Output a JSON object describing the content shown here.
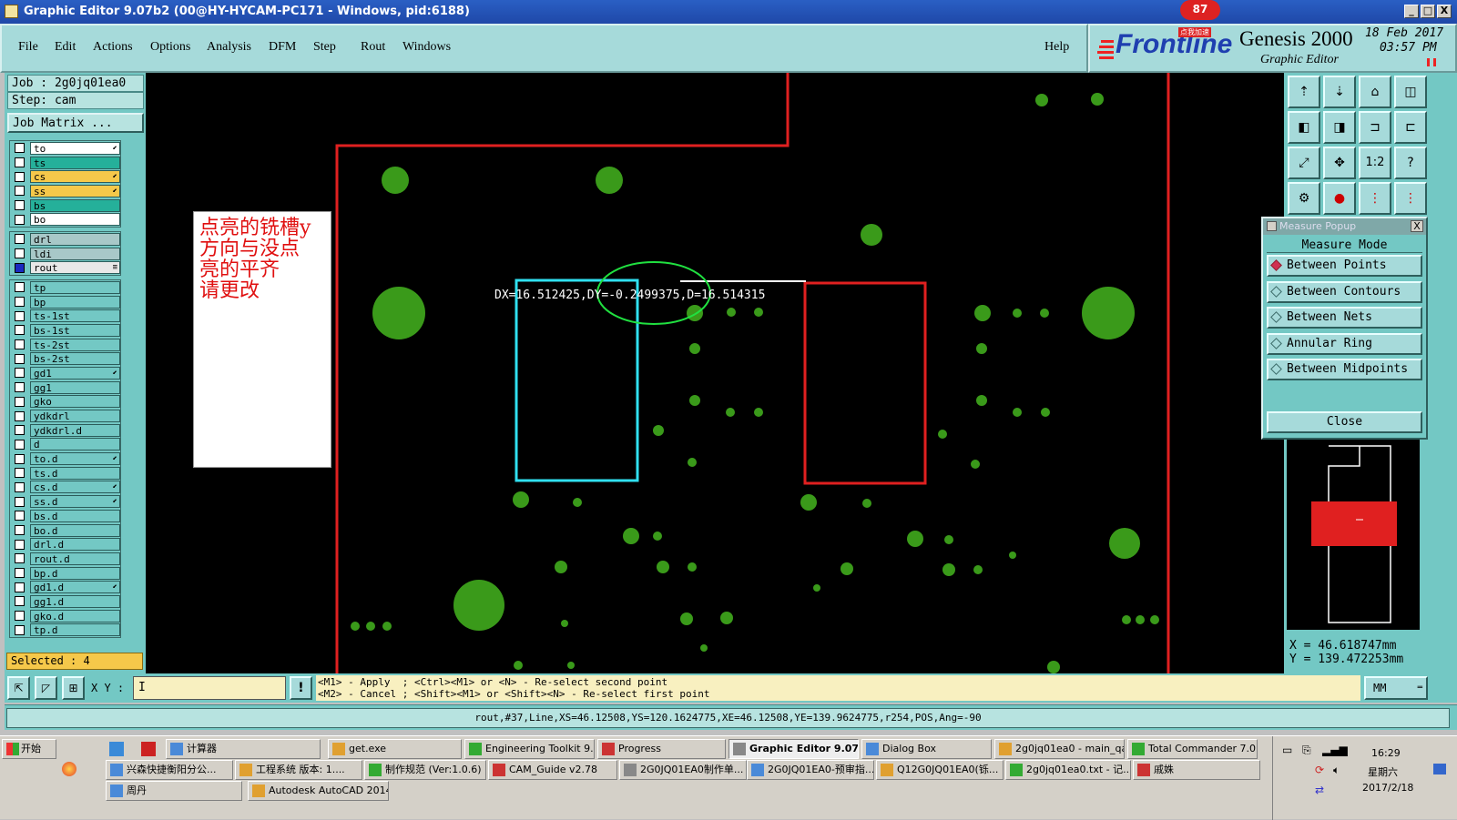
{
  "window": {
    "title": "Graphic Editor 9.07b2 (00@HY-HYCAM-PC171 - Windows, pid:6188)",
    "minimize": "_",
    "maximize": "□",
    "close": "X"
  },
  "badge": {
    "count": "87",
    "text": "点我加速"
  },
  "menu": {
    "items": [
      "File",
      "Edit",
      "Actions",
      "Options",
      "Analysis",
      "DFM",
      "Step",
      "Rout",
      "Windows"
    ],
    "help": "Help"
  },
  "brand": {
    "logo": "Frontline",
    "product": "Genesis 2000",
    "subtitle": "Graphic Editor",
    "date": "18 Feb 2017",
    "time": "03:57 PM"
  },
  "job": {
    "job_line": "Job : 2g0jq01ea0",
    "step_line": "Step: cam",
    "matrix_button": "Job Matrix ...",
    "selected": "Selected : 4"
  },
  "layers_top": [
    {
      "name": "to",
      "color": "#ffffff",
      "mark": "⬋"
    },
    {
      "name": "ts",
      "color": "#25b09a",
      "mark": ""
    },
    {
      "name": "cs",
      "color": "#f5c84a",
      "mark": "⬋"
    },
    {
      "name": "ss",
      "color": "#f5c84a",
      "mark": "⬋"
    },
    {
      "name": "bs",
      "color": "#25b09a",
      "mark": ""
    },
    {
      "name": "bo",
      "color": "#ffffff",
      "mark": ""
    }
  ],
  "layers_mid": [
    {
      "name": "drl",
      "color": "#a8c8c8",
      "mark": ""
    },
    {
      "name": "ldi",
      "color": "#a8c8c8",
      "mark": ""
    },
    {
      "name": "rout",
      "color": "#e8e8e8",
      "mark": "≡"
    }
  ],
  "layers_bottom": [
    {
      "name": "tp",
      "mark": ""
    },
    {
      "name": "bp",
      "mark": ""
    },
    {
      "name": "ts-1st",
      "mark": ""
    },
    {
      "name": "bs-1st",
      "mark": ""
    },
    {
      "name": "ts-2st",
      "mark": ""
    },
    {
      "name": "bs-2st",
      "mark": ""
    },
    {
      "name": "gd1",
      "mark": "⬋"
    },
    {
      "name": "gg1",
      "mark": ""
    },
    {
      "name": "gko",
      "mark": ""
    },
    {
      "name": "ydkdrl",
      "mark": ""
    },
    {
      "name": "ydkdrl.d",
      "mark": ""
    },
    {
      "name": "d",
      "mark": ""
    },
    {
      "name": "to.d",
      "mark": "⬋"
    },
    {
      "name": "ts.d",
      "mark": ""
    },
    {
      "name": "cs.d",
      "mark": "⬋"
    },
    {
      "name": "ss.d",
      "mark": "⬋"
    },
    {
      "name": "bs.d",
      "mark": ""
    },
    {
      "name": "bo.d",
      "mark": ""
    },
    {
      "name": "drl.d",
      "mark": ""
    },
    {
      "name": "rout.d",
      "mark": ""
    },
    {
      "name": "bp.d",
      "mark": ""
    },
    {
      "name": "gd1.d",
      "mark": "⬋"
    },
    {
      "name": "gg1.d",
      "mark": ""
    },
    {
      "name": "gko.d",
      "mark": ""
    },
    {
      "name": "tp.d",
      "mark": ""
    }
  ],
  "canvas": {
    "note_lines": [
      "点亮的铣槽y",
      "方向与没点",
      "亮的平齐",
      "请更改"
    ],
    "measure_readout": "DX=16.512425,DY=-0.2499375,D=16.514315"
  },
  "measure_popup": {
    "title": "Measure Popup",
    "mode_label": "Measure Mode",
    "options": [
      "Between Points",
      "Between Contours",
      "Between Nets",
      "Annular Ring",
      "Between Midpoints"
    ],
    "selected_index": 0,
    "close": "Close"
  },
  "coords": {
    "x": "X = 46.618747mm",
    "y": "Y = 139.472253mm"
  },
  "command": {
    "xy_label": "X Y :",
    "xy_value": "I",
    "hint1": "<M1> - Apply  ; <Ctrl><M1> or <N> - Re-select second point",
    "hint2": "<M2> - Cancel ; <Shift><M1> or <Shift><N> - Re-select first point",
    "units": "MM"
  },
  "status": "rout,#37,Line,XS=46.12508,YS=120.1624775,XE=46.12508,YE=139.9624775,r254,POS,Ang=-90",
  "taskbar": {
    "start": "开始",
    "row1": [
      "计算器",
      "get.exe",
      "Engineering Toolkit 9....",
      "Progress",
      "Graphic Editor 9.07...",
      "Dialog Box",
      "2g0jq01ea0 - main_qa",
      "Total Commander 7.0 ..."
    ],
    "row2": [
      "兴森快捷衡阳分公...",
      "工程系统  版本: 1....",
      "制作规范 (Ver:1.0.6)",
      "CAM_Guide v2.78",
      "2G0JQ01EA0制作单...",
      "2G0JQ01EA0-预审指...",
      "Q12G0JQ01EA0(铄...",
      "2g0jq01ea0.txt - 记...",
      "戚姝"
    ],
    "row3": [
      "周丹",
      "Autodesk AutoCAD 2014..."
    ],
    "clock_time": "16:29",
    "clock_day": "星期六",
    "clock_date": "2017/2/18"
  },
  "colors": {
    "teal_panel": "#73c8c4",
    "menu_bg": "#a6dada",
    "pad_green": "#3a9a1a",
    "rout_red": "#e02020",
    "select_cyan": "#30e0f0",
    "ellipse_green": "#20e040"
  }
}
